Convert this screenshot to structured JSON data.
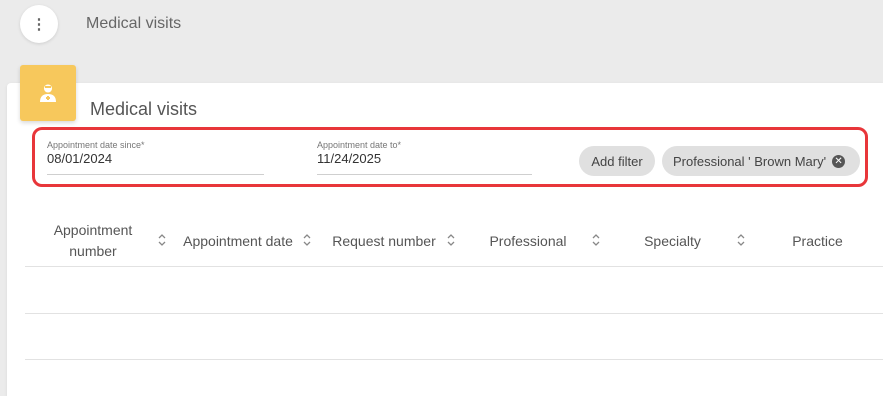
{
  "app": {
    "title": "Medical visits"
  },
  "card": {
    "title": "Medical visits"
  },
  "filters": {
    "date_since": {
      "label": "Appointment date since*",
      "value": "08/01/2024"
    },
    "date_to": {
      "label": "Appointment date to*",
      "value": "11/24/2025"
    },
    "add_filter_label": "Add filter",
    "active_chip": "Professional ' Brown Mary'"
  },
  "table": {
    "columns": [
      {
        "label": "Appointment\nnumber"
      },
      {
        "label": "Appointment date"
      },
      {
        "label": "Request number"
      },
      {
        "label": "Professional"
      },
      {
        "label": "Specialty"
      },
      {
        "label": "Practice"
      }
    ]
  },
  "colors": {
    "accent_icon_bg": "#f7c85c",
    "highlight_border": "#e8363a"
  },
  "icons": {
    "menu": "more-vert-icon",
    "card": "doctor-icon",
    "sort": "sort-icon",
    "chip_remove": "close-circle-icon"
  }
}
